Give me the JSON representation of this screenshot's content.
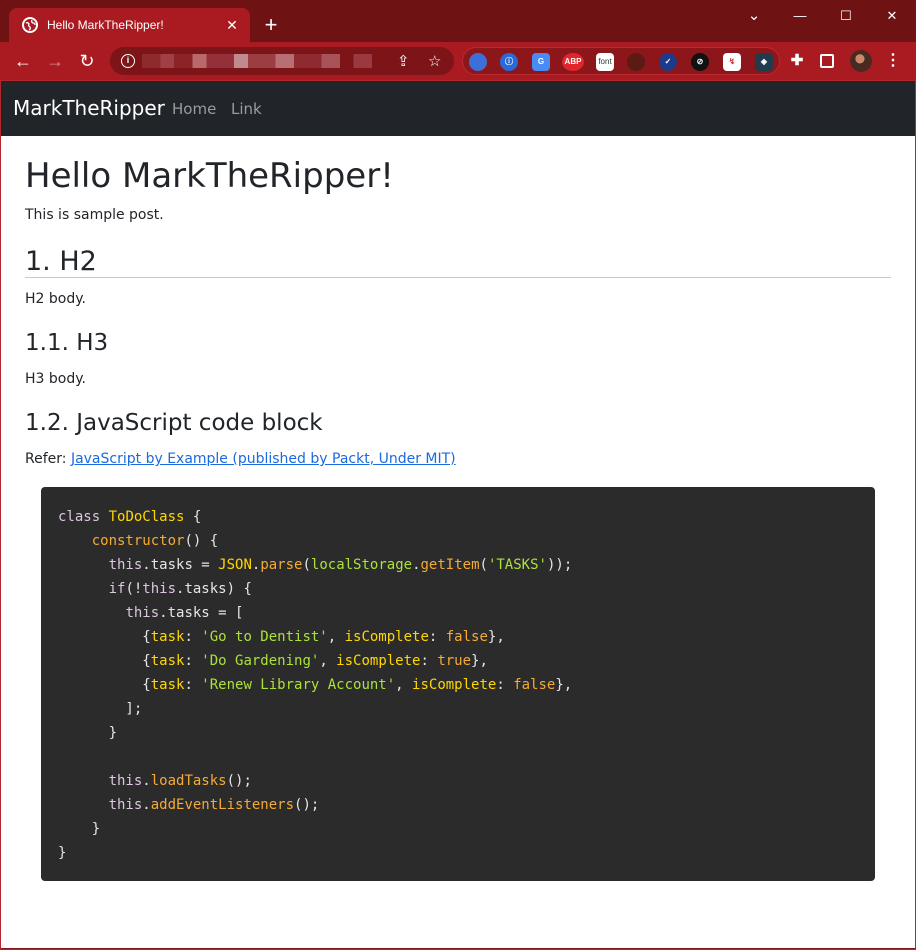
{
  "browser": {
    "tab_title": "Hello MarkTheRipper!",
    "new_tab": "+",
    "window_controls": {
      "minimize": "—",
      "maximize": "☐",
      "close": "✕",
      "tabs_menu": "⌄"
    },
    "nav": {
      "back": "←",
      "forward": "→",
      "reload": "↻"
    },
    "address_obscured": true,
    "extensions": [
      "ABP",
      "font"
    ],
    "menu": "⋮",
    "colors": {
      "frame": "#6e1214",
      "tab": "#a91b21",
      "toolbar": "#a91b21",
      "omnibox": "#7d1418"
    }
  },
  "navbar": {
    "brand": "MarkTheRipper",
    "links": [
      "Home",
      "Link"
    ],
    "background": "#212529"
  },
  "post": {
    "title": "Hello MarkTheRipper!",
    "intro": "This is sample post.",
    "h2": "1. H2",
    "h2_body": "H2 body.",
    "h3": "1.1. H3",
    "h3_body": "H3 body.",
    "h3_code": "1.2. JavaScript code block",
    "refer_label": "Refer: ",
    "refer_link": "JavaScript by Example (published by Packt, Under MIT)"
  },
  "code": {
    "lines": [
      "class ToDoClass {",
      "    constructor() {",
      "      this.tasks = JSON.parse(localStorage.getItem('TASKS'));",
      "      if(!this.tasks) {",
      "        this.tasks = [",
      "          {task: 'Go to Dentist', isComplete: false},",
      "          {task: 'Do Gardening', isComplete: true},",
      "          {task: 'Renew Library Account', isComplete: false},",
      "        ];",
      "      }",
      "",
      "      this.loadTasks();",
      "      this.addEventListeners();",
      "    }",
      "}"
    ]
  }
}
